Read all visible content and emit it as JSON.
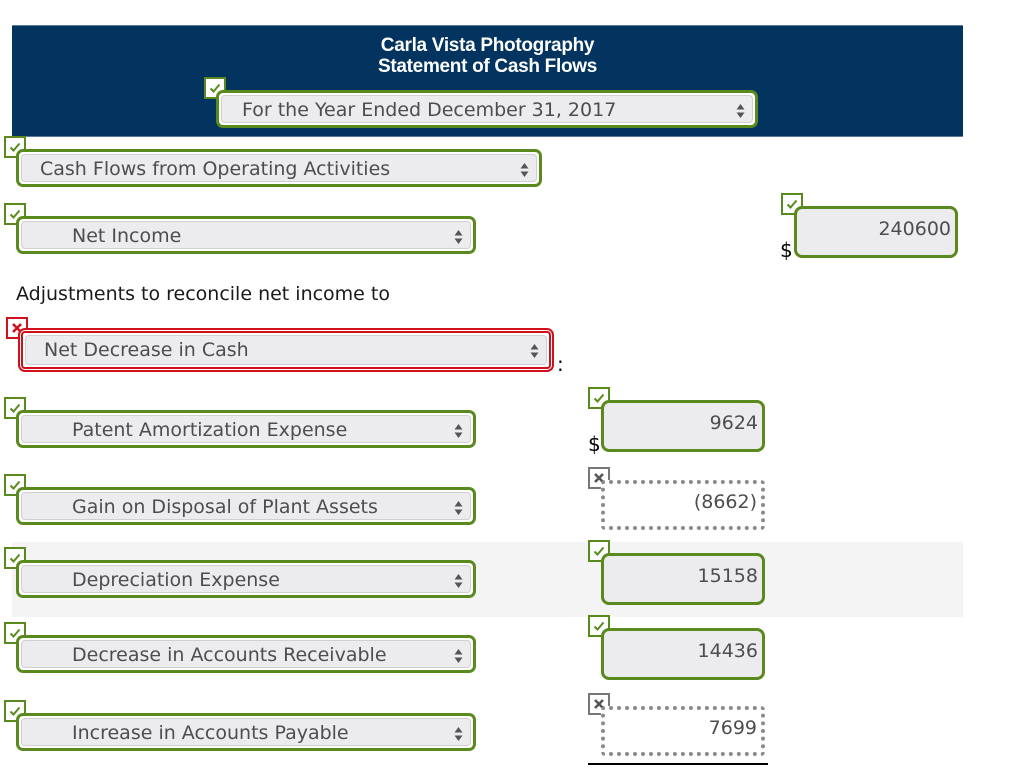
{
  "header": {
    "company": "Carla Vista Photography",
    "statement": "Statement of Cash Flows",
    "period_select": {
      "value": "For the Year Ended December 31, 2017",
      "status": "correct"
    }
  },
  "section_select": {
    "value": "Cash Flows from Operating Activities",
    "status": "correct"
  },
  "net_income": {
    "select": {
      "value": "Net Income",
      "status": "correct"
    },
    "currency": "$",
    "amount": {
      "value": "240600",
      "status": "correct"
    }
  },
  "adjustments": {
    "label": "Adjustments to reconcile net income to",
    "target_select": {
      "value": "Net Decrease in Cash",
      "status": "incorrect"
    },
    "colon": ":",
    "currency": "$",
    "rows": [
      {
        "label": "Patent Amortization Expense",
        "label_status": "correct",
        "amount": "9624",
        "amount_status": "correct"
      },
      {
        "label": "Gain on Disposal of Plant Assets",
        "label_status": "correct",
        "amount": "(8662)",
        "amount_status": "incorrect"
      },
      {
        "label": "Depreciation Expense",
        "label_status": "correct",
        "amount": "15158",
        "amount_status": "correct"
      },
      {
        "label": "Decrease in Accounts Receivable",
        "label_status": "correct",
        "amount": "14436",
        "amount_status": "correct"
      },
      {
        "label": "Increase in Accounts Payable",
        "label_status": "correct",
        "amount": "7699",
        "amount_status": "incorrect"
      }
    ]
  },
  "colors": {
    "header_bg": "#03335f",
    "correct": "#5a8a1e",
    "incorrect": "#d0111b",
    "neutral_wrong": "#8a8a8a"
  }
}
